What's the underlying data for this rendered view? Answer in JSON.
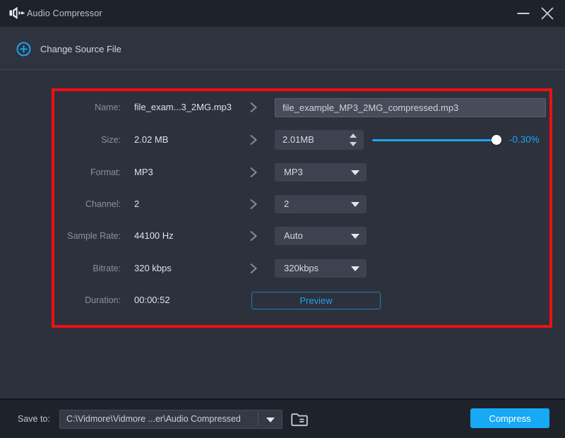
{
  "window": {
    "title": "Audio Compressor",
    "controls": {
      "minimize": "minimize",
      "close": "close"
    }
  },
  "header": {
    "change_source_label": "Change Source File"
  },
  "panel": {
    "rows": [
      {
        "label": "Name:",
        "value": "file_exam...3_2MG.mp3",
        "control": "input",
        "input_value": "file_example_MP3_2MG_compressed.mp3"
      },
      {
        "label": "Size:",
        "value": "2.02 MB",
        "control": "spinner",
        "spinner_value": "2.01MB",
        "slider_percent": 96,
        "delta": "-0.30%"
      },
      {
        "label": "Format:",
        "value": "MP3",
        "control": "select",
        "selected": "MP3"
      },
      {
        "label": "Channel:",
        "value": "2",
        "control": "select",
        "selected": "2"
      },
      {
        "label": "Sample Rate:",
        "value": "44100 Hz",
        "control": "select",
        "selected": "Auto"
      },
      {
        "label": "Bitrate:",
        "value": "320 kbps",
        "control": "select",
        "selected": "320kbps"
      },
      {
        "label": "Duration:",
        "value": "00:00:52",
        "control": "button",
        "button_label": "Preview"
      }
    ]
  },
  "footer": {
    "save_to_label": "Save to:",
    "save_path": "C:\\Vidmore\\Vidmore ...er\\Audio Compressed",
    "compress_label": "Compress"
  },
  "icons": {
    "app": "speaker-compress-icon",
    "add": "plus-circle-icon",
    "row_arrow": "chevron-right-icon",
    "dropdown": "caret-down-icon",
    "browse": "folder-icon"
  },
  "colors": {
    "accent": "#1da4f2",
    "annotation": "#ee1010",
    "compress_bg": "#17a9f4"
  }
}
